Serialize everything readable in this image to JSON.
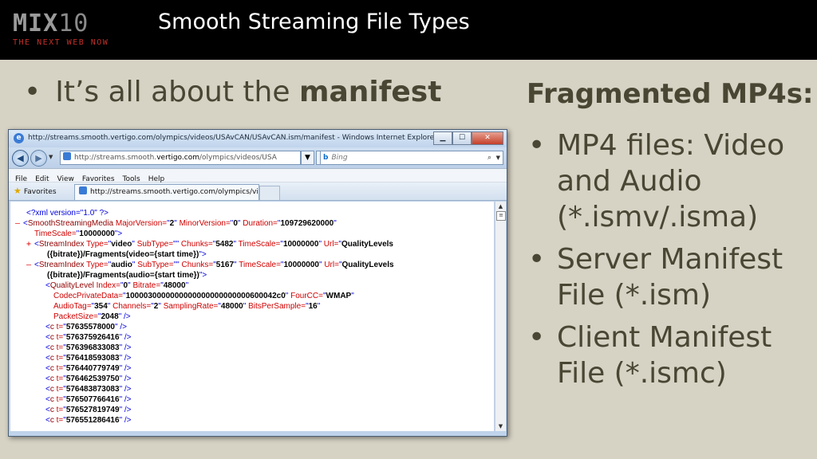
{
  "header": {
    "logo_letters": "MIX",
    "logo_number": "10",
    "logo_tagline": "THE NEXT WEB NOW",
    "title": "Smooth Streaming File Types"
  },
  "left": {
    "bullet_prefix": "It’s all about the ",
    "bullet_bold": "manifest"
  },
  "right": {
    "heading": "Fragmented MP4s:",
    "items": [
      "MP4 files: Video and Audio (*.ismv/.isma)",
      "Server Manifest File (*.ism)",
      "Client Manifest File (*.ismc)"
    ]
  },
  "browser": {
    "window_title": "http://streams.smooth.vertigo.com/olympics/videos/USAvCAN/USAvCAN.ism/manifest - Windows Internet Explorer",
    "address_prefix": "http://streams.smooth.",
    "address_domain": "vertigo.com",
    "address_suffix": "/olympics/videos/USA",
    "search_placeholder": "Bing",
    "menu": [
      "File",
      "Edit",
      "View",
      "Favorites",
      "Tools",
      "Help"
    ],
    "favorites_label": "Favorites",
    "tab_label": "http://streams.smooth.vertigo.com/olympics/vi...",
    "xml": {
      "decl": "<?xml version=\"1.0\" ?>",
      "ssm_tag": "SmoothStreamingMedia",
      "major_attr": "MajorVersion=",
      "major_val": "2",
      "minor_attr": "MinorVersion=",
      "minor_val": "0",
      "duration_attr": "Duration=",
      "duration_val": "109729620000",
      "timescale_attr": "TimeScale=",
      "timescale_val": "10000000",
      "si_tag": "StreamIndex",
      "type_attr": "Type=",
      "video_val": "video",
      "audio_val": "audio",
      "subtype_attr": "SubType=",
      "chunks_attr": "Chunks=",
      "video_chunks": "5482",
      "audio_chunks": "5167",
      "url_attr": "Url=",
      "url_val_start": "QualityLevels",
      "video_url_end": "({bitrate})/Fragments(video={start time})",
      "audio_url_end": "({bitrate})/Fragments(audio={start time})",
      "ql_tag": "QualityLevel",
      "index_attr": "Index=",
      "index_val": "0",
      "bitrate_attr": "Bitrate=",
      "bitrate_val": "48000",
      "cpd_attr": "CodecPrivateData=",
      "cpd_val": "1000030000000000000000000000600042c0",
      "fourcc_attr": "FourCC=",
      "fourcc_val": "WMAP",
      "audiotag_attr": "AudioTag=",
      "audiotag_val": "354",
      "channels_attr": "Channels=",
      "channels_val": "2",
      "sampling_attr": "SamplingRate=",
      "sampling_val": "48000",
      "bps_attr": "BitsPerSample=",
      "bps_val": "16",
      "packet_attr": "PacketSize=",
      "packet_val": "2048",
      "c_tag": "c",
      "t_attr": "t=",
      "c_values": [
        "57635578000",
        "576375926416",
        "576396833083",
        "576418593083",
        "576440779749",
        "576462539750",
        "576483873083",
        "576507766416",
        "576527819749",
        "576551286416"
      ]
    }
  }
}
